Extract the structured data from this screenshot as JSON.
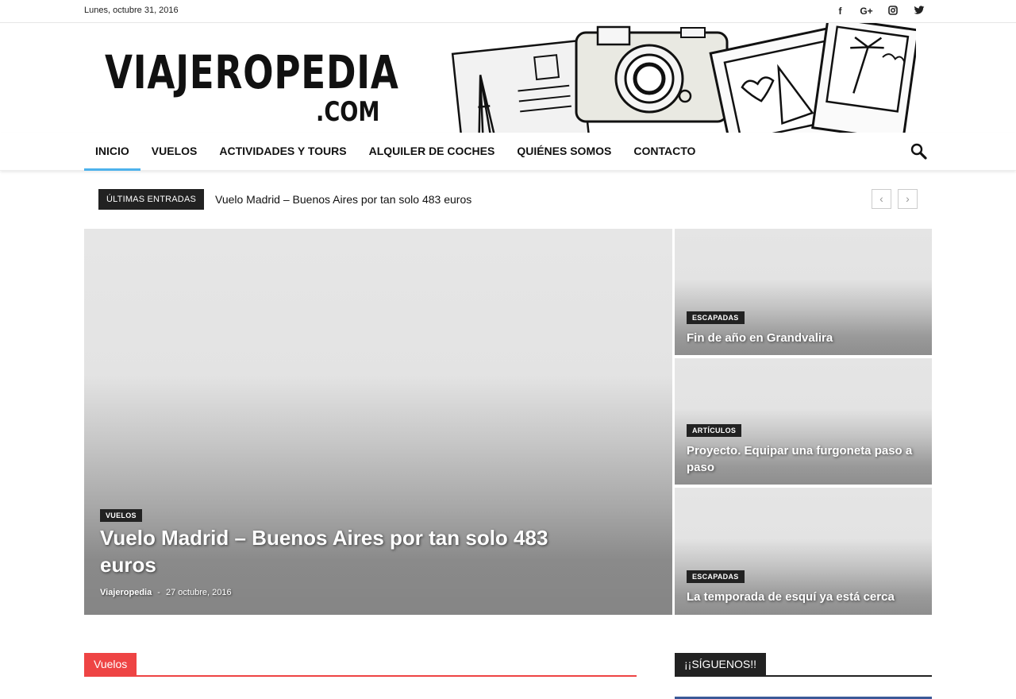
{
  "topbar": {
    "date": "Lunes, octubre 31, 2016",
    "social_icons": [
      "facebook-icon",
      "google-plus-icon",
      "instagram-icon",
      "twitter-icon"
    ],
    "social_glyphs": [
      "f",
      "G+",
      "◎",
      "🐦"
    ]
  },
  "header": {
    "logo_main": "VIAJEROPEDIA",
    "logo_sub": ".COM"
  },
  "nav": {
    "items": [
      "INICIO",
      "VUELOS",
      "ACTIVIDADES Y TOURS",
      "ALQUILER DE COCHES",
      "QUIÉNES SOMOS",
      "CONTACTO"
    ],
    "active_index": 0,
    "accent_color": "#4db2ec"
  },
  "ticker": {
    "label": "ÚLTIMAS ENTRADAS",
    "text": "Vuelo Madrid – Buenos Aires por tan solo 483 euros",
    "prev": "‹",
    "next": "›"
  },
  "feature": {
    "category": "VUELOS",
    "title": "Vuelo Madrid – Buenos Aires por tan solo 483 euros",
    "author": "Viajeropedia",
    "separator": "-",
    "date": "27 octubre, 2016"
  },
  "side_posts": [
    {
      "category": "ESCAPADAS",
      "title": "Fin de año en Grandvalira"
    },
    {
      "category": "ARTÍCULOS",
      "title": "Proyecto. Equipar una furgoneta paso a paso"
    },
    {
      "category": "ESCAPADAS",
      "title": "La temporada de esquí ya está cerca"
    }
  ],
  "sections": {
    "left": "Vuelos",
    "right": "¡¡SÍGUENOS!!"
  },
  "colors": {
    "section_red": "#e44",
    "dark": "#222",
    "facebook_blue": "#3b5998"
  }
}
